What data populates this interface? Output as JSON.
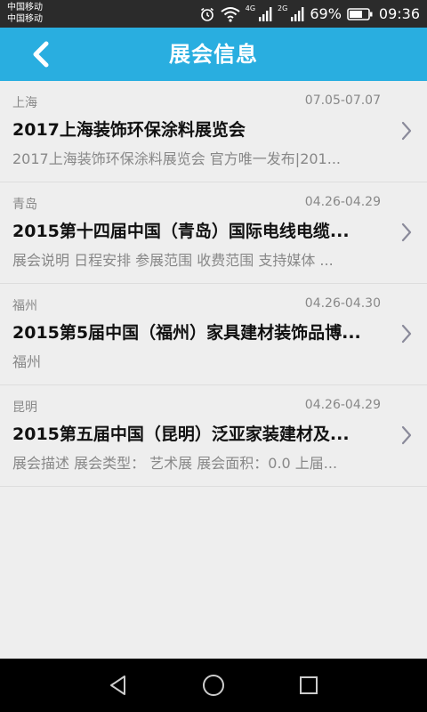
{
  "status_bar": {
    "carrier_1": "中国移动",
    "carrier_2": "中国移动",
    "net_4g": "4G",
    "net_2g": "2G",
    "battery": "69%",
    "time": "09:36"
  },
  "header": {
    "title": "展会信息"
  },
  "exhibitions": [
    {
      "city": "上海",
      "date": "07.05-07.07",
      "title": "2017上海装饰环保涂料展览会",
      "desc": "2017上海装饰环保涂料展览会 官方唯一发布|201..."
    },
    {
      "city": "青岛",
      "date": "04.26-04.29",
      "title": "2015第十四届中国（青岛）国际电线电缆...",
      "desc": "展会说明 日程安排 参展范围 收费范围 支持媒体 ..."
    },
    {
      "city": "福州",
      "date": "04.26-04.30",
      "title": "2015第5届中国（福州）家具建材装饰品博...",
      "desc": "福州"
    },
    {
      "city": "昆明",
      "date": "04.26-04.29",
      "title": "2015第五届中国（昆明）泛亚家装建材及...",
      "desc": "展会描述  展会类型：  艺术展 展会面积：0.0 上届..."
    }
  ],
  "colors": {
    "header_bg": "#29aee0",
    "status_bar_bg": "#2b2b2b",
    "nav_bar_bg": "#000000",
    "list_bg": "#eeeeee"
  }
}
